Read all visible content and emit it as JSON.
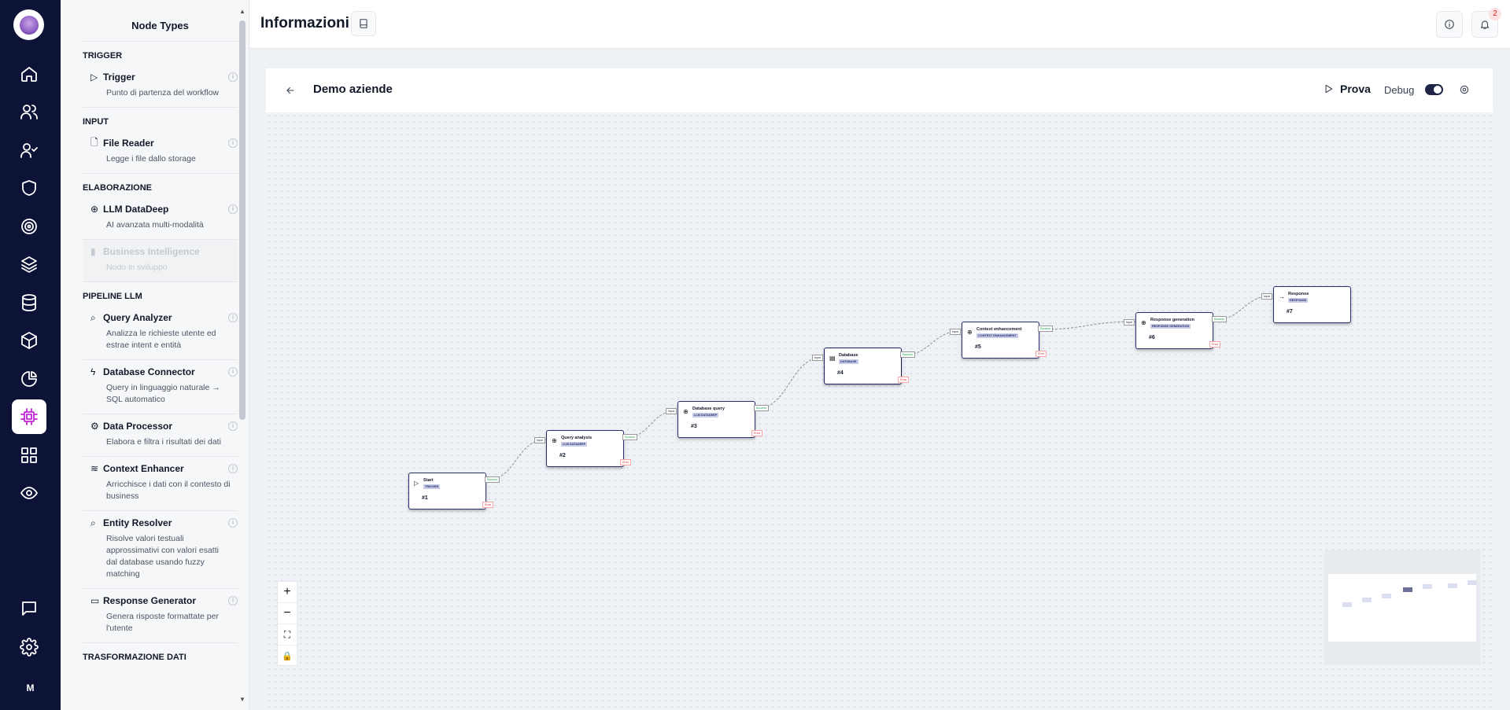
{
  "sidebar": {
    "user_initial": "M"
  },
  "panel": {
    "title": "Node Types",
    "sections": [
      {
        "label": "TRIGGER",
        "items": [
          {
            "icon": "play-icon",
            "label": "Trigger",
            "desc": "Punto di partenza del workflow"
          }
        ]
      },
      {
        "label": "INPUT",
        "items": [
          {
            "icon": "file-icon",
            "label": "File Reader",
            "desc": "Legge i file dallo storage"
          }
        ]
      },
      {
        "label": "ELABORAZIONE",
        "items": [
          {
            "icon": "globe-icon",
            "label": "LLM DataDeep",
            "desc": "AI avanzata multi-modalità"
          },
          {
            "icon": "bar-chart-icon",
            "label": "Business Intelligence",
            "desc": "Nodo in sviluppo",
            "disabled": true
          }
        ]
      },
      {
        "label": "PIPELINE LLM",
        "items": [
          {
            "icon": "search-icon",
            "label": "Query Analyzer",
            "desc": "Analizza le richieste utente ed estrae intent e entità"
          },
          {
            "icon": "bolt-icon",
            "label": "Database Connector",
            "desc": "Query in linguaggio naturale → SQL automatico"
          },
          {
            "icon": "cog-icon",
            "label": "Data Processor",
            "desc": "Elabora e filtra i risultati dei dati"
          },
          {
            "icon": "layers-icon",
            "label": "Context Enhancer",
            "desc": "Arricchisce i dati con il contesto di business"
          },
          {
            "icon": "search-icon",
            "label": "Entity Resolver",
            "desc": "Risolve valori testuali approssimativi con valori esatti dal database usando fuzzy matching"
          },
          {
            "icon": "message-icon",
            "label": "Response Generator",
            "desc": "Genera risposte formattate per l'utente"
          }
        ]
      },
      {
        "label": "TRASFORMAZIONE DATI",
        "items": []
      }
    ]
  },
  "topbar": {
    "title": "Informazioni",
    "notifications": "2"
  },
  "workflow": {
    "name": "Demo aziende",
    "run_label": "Prova",
    "debug_label": "Debug",
    "nodes": [
      {
        "title": "Start",
        "tag": "TRIGGER",
        "id": "#1",
        "icon": "play-icon"
      },
      {
        "title": "Query analysis",
        "tag": "LLM DATADEEP",
        "id": "#2",
        "icon": "globe-icon"
      },
      {
        "title": "Database query",
        "tag": "LLM DATADEEP",
        "id": "#3",
        "icon": "globe-icon"
      },
      {
        "title": "Database",
        "tag": "DATABASE",
        "id": "#4",
        "icon": "database-icon"
      },
      {
        "title": "Context enhancement",
        "tag": "CONTEXT ENHANCEMENT",
        "id": "#5",
        "icon": "globe-icon"
      },
      {
        "title": "Response generation",
        "tag": "RESPONSE GENERATION",
        "id": "#6",
        "icon": "globe-icon"
      },
      {
        "title": "Response",
        "tag": "RESPONSE",
        "id": "#7",
        "icon": "arrow-icon"
      }
    ],
    "port_labels": {
      "input": "Input",
      "success": "Success",
      "error": "Error"
    }
  }
}
